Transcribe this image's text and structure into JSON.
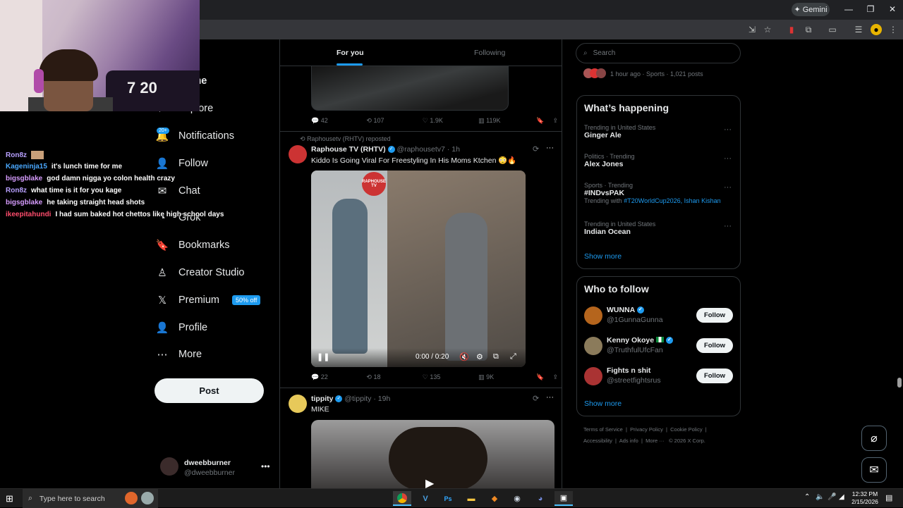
{
  "browser": {
    "gemini_label": "Gemini",
    "window_controls": [
      "—",
      "❐",
      "✕"
    ]
  },
  "chat": [
    {
      "user": "Ron8z",
      "color": "#b8a0ff",
      "msg": ""
    },
    {
      "user": "Kageninja15",
      "color": "#4aa8ff",
      "msg": "it's lunch time for me"
    },
    {
      "user": "bigsgblake",
      "color": "#d79cff",
      "msg": "god damn nigga yo colon health crazy"
    },
    {
      "user": "Ron8z",
      "color": "#b8a0ff",
      "msg": "what time is it for you kage"
    },
    {
      "user": "bigsgblake",
      "color": "#d79cff",
      "msg": "he taking straight head shots"
    },
    {
      "user": "ikeepitahundi",
      "color": "#ff4d6d",
      "msg": "I had sum baked hot chettos like high school days"
    }
  ],
  "webcam": {
    "jersey_text": "7 20"
  },
  "nav": {
    "items": [
      {
        "label": "Home",
        "icon": "⌂"
      },
      {
        "label": "Explore",
        "icon": "⌕"
      },
      {
        "label": "Notifications",
        "icon": "🔔"
      },
      {
        "label": "Follow",
        "icon": "👤"
      },
      {
        "label": "Chat",
        "icon": "✉"
      },
      {
        "label": "Grok",
        "icon": "◔"
      },
      {
        "label": "Bookmarks",
        "icon": "🔖"
      },
      {
        "label": "Creator Studio",
        "icon": "♙"
      },
      {
        "label": "Premium",
        "icon": "𝕏"
      },
      {
        "label": "Profile",
        "icon": "👤"
      },
      {
        "label": "More",
        "icon": "⋯"
      }
    ],
    "notif_badge": "20+",
    "premium_badge": "50% off",
    "post_label": "Post"
  },
  "account": {
    "name": "dweebburner",
    "handle": "@dweebburner"
  },
  "feed": {
    "tabs": [
      "For you",
      "Following"
    ],
    "post0": {
      "replies": "42",
      "reposts": "107",
      "likes": "1.9K",
      "views": "119K"
    },
    "post1": {
      "reposted_by": "Raphousetv (RHTV) reposted",
      "name": "Raphouse TV (RHTV)",
      "handle": "@raphousetv7",
      "time": "1h",
      "text": "Kiddo Is Going Viral For Freestyling In His Moms Ktchen 😳🔥",
      "video_time": "0:00 / 0:20",
      "logo_text": "RAPHOUSE TV",
      "replies": "22",
      "reposts": "18",
      "likes": "135",
      "views": "9K"
    },
    "post2": {
      "name": "tippity",
      "handle": "@tippity",
      "time": "19h",
      "text": "MIKE"
    }
  },
  "right": {
    "search_placeholder": "Search",
    "top_meta": "1 hour ago · Sports · 1,021 posts",
    "happening_title": "What’s happening",
    "trends": [
      {
        "cat": "Trending in United States",
        "name": "Ginger Ale",
        "with": ""
      },
      {
        "cat": "Politics · Trending",
        "name": "Alex Jones",
        "with": ""
      },
      {
        "cat": "Sports · Trending",
        "name": "#INDvsPAK",
        "with_label": "Trending with",
        "with": "#T20WorldCup2026, Ishan Kishan"
      },
      {
        "cat": "Trending in United States",
        "name": "Indian Ocean",
        "with": ""
      }
    ],
    "show_more": "Show more",
    "who_title": "Who to follow",
    "follow": [
      {
        "name": "WUNNA",
        "handle": "@1GunnaGunna",
        "avatar_color": "#b5651d"
      },
      {
        "name": "Kenny Okoye",
        "handle": "@TruthfulUfcFan",
        "avatar_color": "#8b7b5b"
      },
      {
        "name": "Fights n shit",
        "handle": "@streetfightsrus",
        "avatar_color": "#a33"
      }
    ],
    "follow_label": "Follow",
    "footer": [
      "Terms of Service",
      "Privacy Policy",
      "Cookie Policy",
      "Accessibility",
      "Ads info",
      "More ···",
      "© 2026 X Corp."
    ]
  },
  "taskbar": {
    "search_placeholder": "Type here to search",
    "time": "12:32 PM",
    "date": "2/15/2026"
  }
}
